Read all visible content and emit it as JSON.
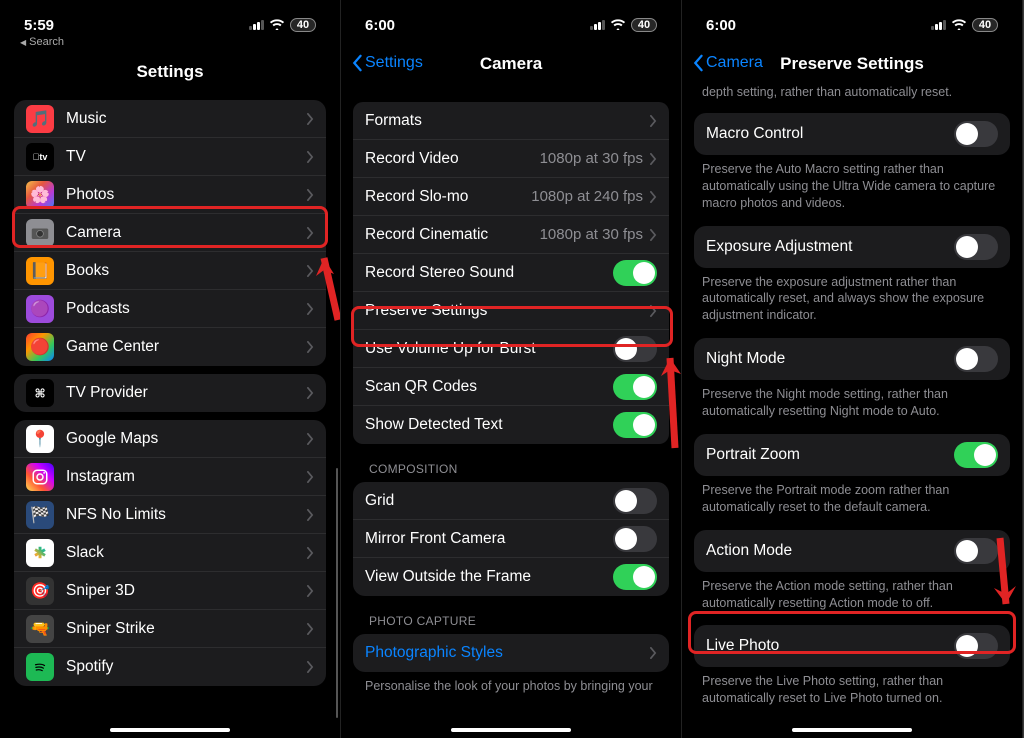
{
  "phone1": {
    "time": "5:59",
    "battery": "40",
    "back_search": "Search",
    "title": "Settings",
    "group1": [
      {
        "label": "Music",
        "icon": "🎵",
        "bg": "#fc3c44"
      },
      {
        "label": "TV",
        "icon": "tv",
        "bg": "#000"
      },
      {
        "label": "Photos",
        "icon": "🌸",
        "bg": "linear-gradient(135deg,#f5c04a,#e6573f,#b73bd6,#3b82f6)"
      },
      {
        "label": "Camera",
        "icon": "📷",
        "bg": "#8e8e93"
      },
      {
        "label": "Books",
        "icon": "📙",
        "bg": "#ff9500"
      },
      {
        "label": "Podcasts",
        "icon": "🟣",
        "bg": "#9d4bdc"
      },
      {
        "label": "Game Center",
        "icon": "🔴",
        "bg": "linear-gradient(135deg,#ff3b30,#ff9500,#34c759,#0a84ff)"
      }
    ],
    "group2": [
      {
        "label": "TV Provider",
        "icon": "S",
        "bg": "#000"
      }
    ],
    "group3": [
      {
        "label": "Google Maps",
        "icon": "📍",
        "bg": "#fff"
      },
      {
        "label": "Instagram",
        "icon": "ig",
        "bg": "linear-gradient(45deg,#fd5,#f53,#c0f,#40f)"
      },
      {
        "label": "NFS No Limits",
        "icon": "🏁",
        "bg": "#2a4a7a"
      },
      {
        "label": "Slack",
        "icon": "sl",
        "bg": "#fff"
      },
      {
        "label": "Sniper 3D",
        "icon": "🎯",
        "bg": "#333"
      },
      {
        "label": "Sniper Strike",
        "icon": "🔫",
        "bg": "#444"
      },
      {
        "label": "Spotify",
        "icon": "sp",
        "bg": "#1db954"
      }
    ]
  },
  "phone2": {
    "time": "6:00",
    "battery": "40",
    "back": "Settings",
    "title": "Camera",
    "group1": [
      {
        "label": "Formats",
        "type": "chev"
      },
      {
        "label": "Record Video",
        "value": "1080p at 30 fps",
        "type": "chev"
      },
      {
        "label": "Record Slo-mo",
        "value": "1080p at 240 fps",
        "type": "chev"
      },
      {
        "label": "Record Cinematic",
        "value": "1080p at 30 fps",
        "type": "chev"
      },
      {
        "label": "Record Stereo Sound",
        "type": "toggle",
        "on": true
      },
      {
        "label": "Preserve Settings",
        "type": "chev"
      },
      {
        "label": "Use Volume Up for Burst",
        "type": "toggle",
        "on": false
      },
      {
        "label": "Scan QR Codes",
        "type": "toggle",
        "on": true
      },
      {
        "label": "Show Detected Text",
        "type": "toggle",
        "on": true
      }
    ],
    "section2_header": "COMPOSITION",
    "group2": [
      {
        "label": "Grid",
        "type": "toggle",
        "on": false
      },
      {
        "label": "Mirror Front Camera",
        "type": "toggle",
        "on": false
      },
      {
        "label": "View Outside the Frame",
        "type": "toggle",
        "on": true
      }
    ],
    "section3_header": "PHOTO CAPTURE",
    "group3": [
      {
        "label": "Photographic Styles",
        "type": "chev",
        "blue": true
      }
    ],
    "footer3": "Personalise the look of your photos by bringing your"
  },
  "phone3": {
    "time": "6:00",
    "battery": "40",
    "back": "Camera",
    "title": "Preserve Settings",
    "top_footer": "depth setting, rather than automatically reset.",
    "items": [
      {
        "label": "Macro Control",
        "on": false,
        "footer": "Preserve the Auto Macro setting rather than automatically using the Ultra Wide camera to capture macro photos and videos."
      },
      {
        "label": "Exposure Adjustment",
        "on": false,
        "footer": "Preserve the exposure adjustment rather than automatically reset, and always show the exposure adjustment indicator."
      },
      {
        "label": "Night Mode",
        "on": false,
        "footer": "Preserve the Night mode setting, rather than automatically resetting Night mode to Auto."
      },
      {
        "label": "Portrait Zoom",
        "on": true,
        "footer": "Preserve the Portrait mode zoom rather than automatically reset to the default camera."
      },
      {
        "label": "Action Mode",
        "on": false,
        "footer": "Preserve the Action mode setting, rather than automatically resetting Action mode to off."
      },
      {
        "label": "Live Photo",
        "on": false,
        "footer": "Preserve the Live Photo setting, rather than automatically reset to Live Photo turned on."
      }
    ]
  }
}
